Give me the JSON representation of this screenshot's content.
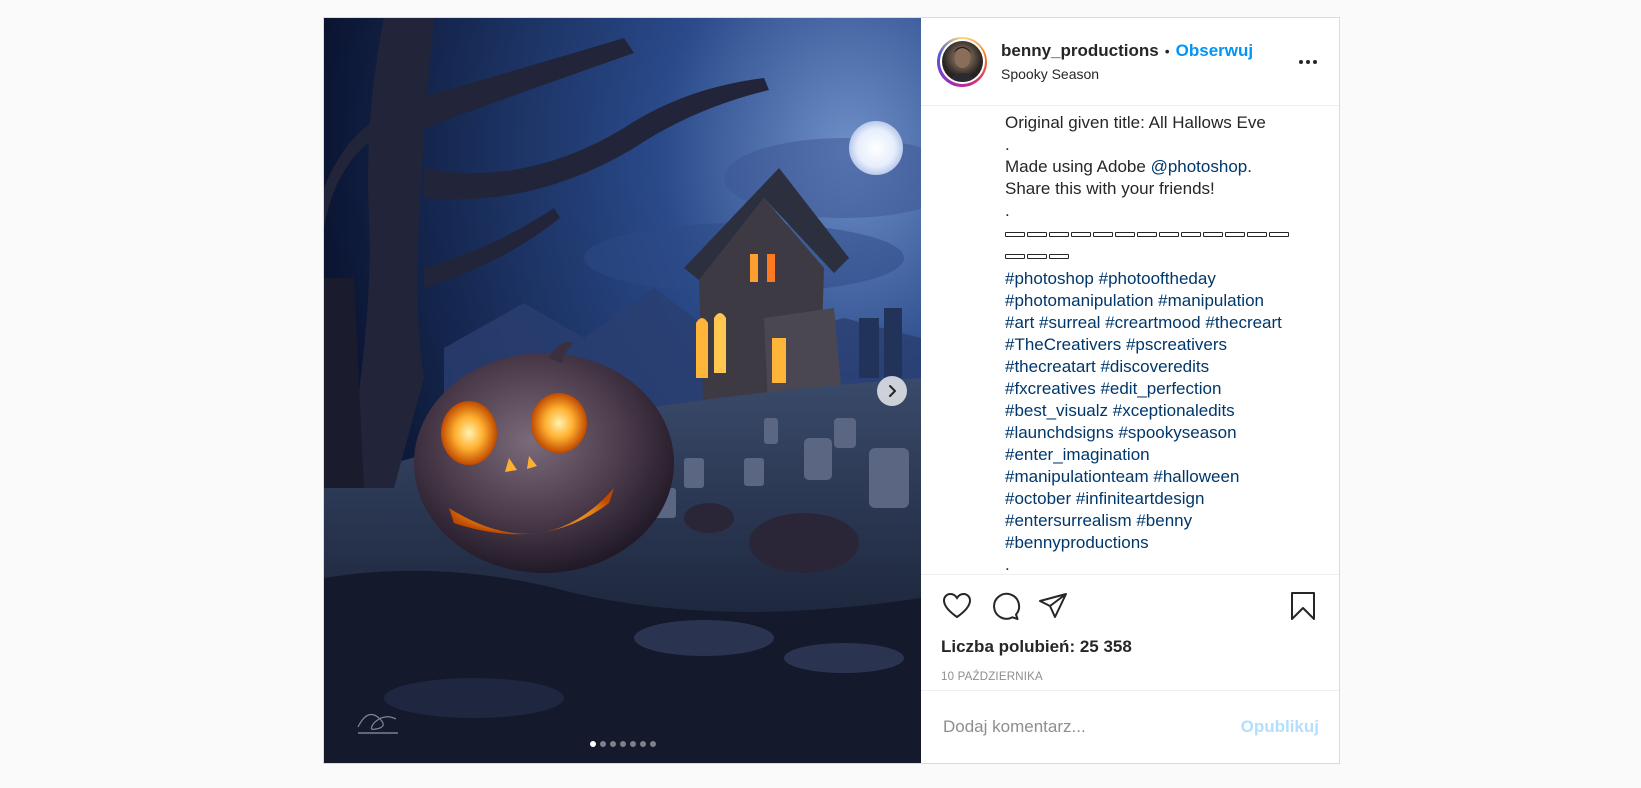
{
  "post": {
    "username": "benny_productions",
    "separator": "•",
    "follow_label": "Obserwuj",
    "location": "Spooky Season",
    "carousel": {
      "slide_count": 7,
      "active_index": 0
    }
  },
  "caption": {
    "title_line": "Original given title: All Hallows Eve",
    "dot1": ".",
    "made_prefix": "Made using Adobe ",
    "made_mention": "@photoshop",
    "made_suffix": ".",
    "share_line": "Share this with your friends!",
    "dot2": ".",
    "dash_count": 16,
    "hashtag_lines": [
      "#photoshop #photooftheday",
      "#photomanipulation #manipulation",
      "#art #surreal #creartmood #thecreart",
      "#TheCreativers #pscreativers",
      "#thecreatart #discoveredits",
      "#fxcreatives #edit_perfection",
      "#best_visualz #xceptionaledits",
      "#launchdsigns #spookyseason",
      "#enter_imagination",
      "#manipulationteam #halloween",
      "#october #infiniteartdesign",
      "#entersurrealism #benny",
      "#bennyproductions"
    ],
    "dot3": "."
  },
  "engagement": {
    "likes_text": "Liczba polubień: 25 358",
    "date_text": "10 PAŹDZIERNIKA"
  },
  "comment": {
    "placeholder": "Dodaj komentarz...",
    "publish_label": "Opublikuj"
  },
  "icons": [
    "heart-icon",
    "comment-icon",
    "share-icon",
    "bookmark-icon",
    "chevron-right-icon",
    "more-icon"
  ]
}
